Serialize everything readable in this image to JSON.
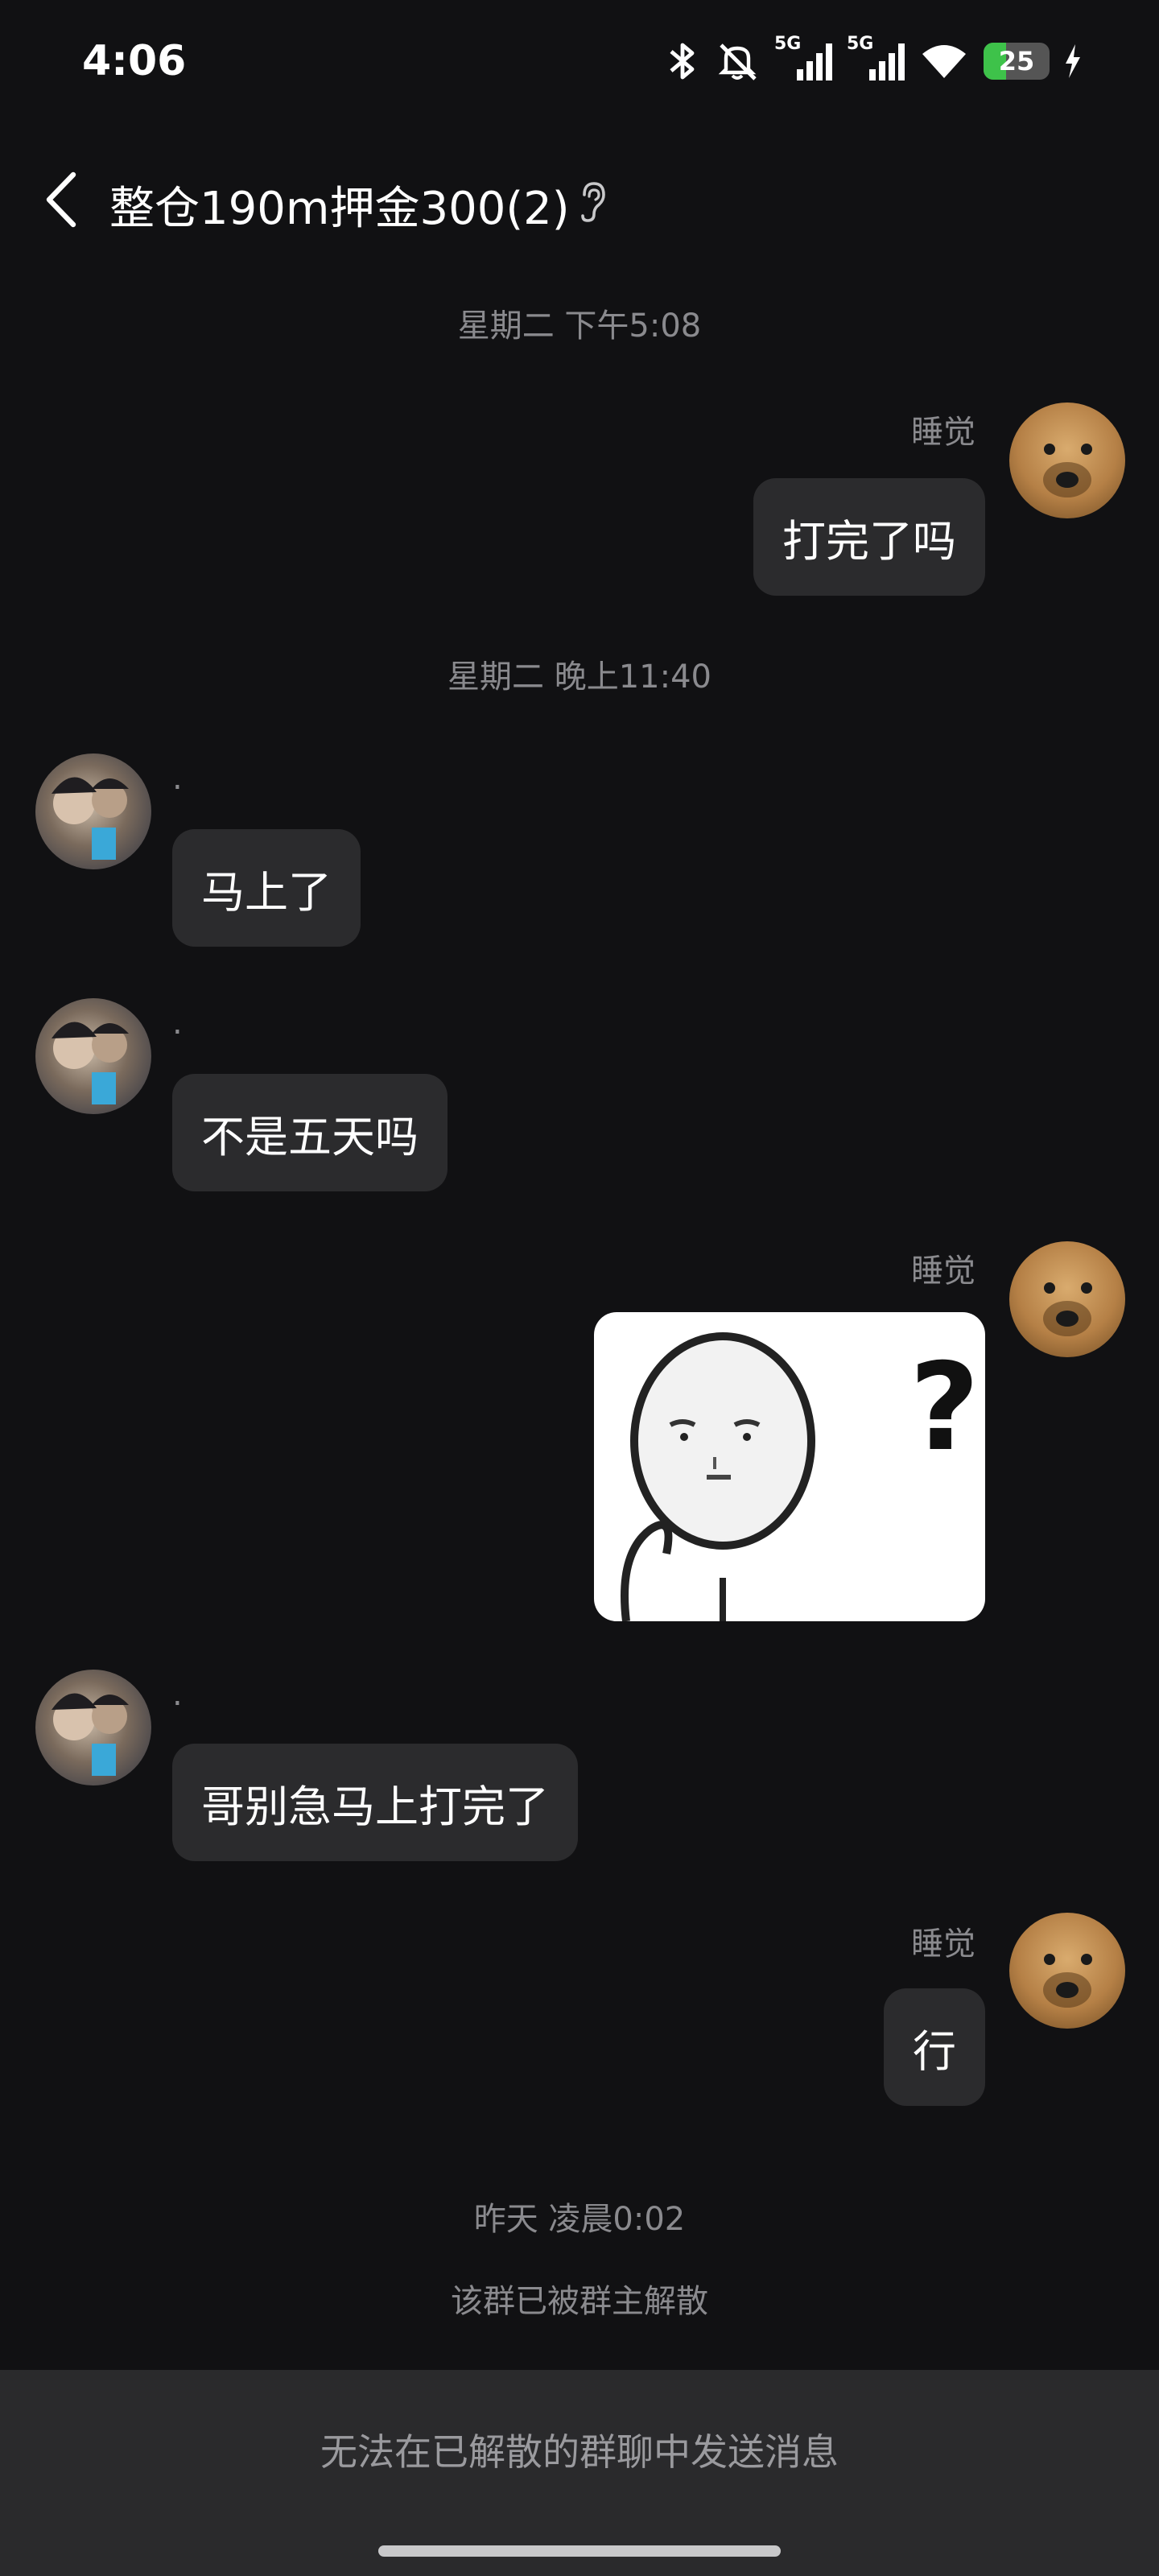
{
  "status_bar": {
    "time": "4:06",
    "battery": "25",
    "network_1": "5G",
    "network_2": "5G",
    "icons": [
      "bluetooth-icon",
      "mute-icon",
      "signal-icon",
      "signal-icon",
      "wifi-icon",
      "battery-icon",
      "charging-icon"
    ]
  },
  "header": {
    "title": "整仓190m押金300(2)",
    "back_icon": "chevron-left-icon",
    "ear_icon": "ear-icon"
  },
  "messages": {
    "timestamp_1": "星期二 下午5:08",
    "msg_1": {
      "sender": "睡觉",
      "text": "打完了吗"
    },
    "timestamp_2": "星期二 晚上11:40",
    "msg_2": {
      "sender": ".",
      "text": "马上了"
    },
    "msg_3": {
      "sender": ".",
      "text": "不是五天吗"
    },
    "msg_4": {
      "sender": "睡觉",
      "sticker_text": "?"
    },
    "msg_5": {
      "sender": ".",
      "text": "哥别急马上打完了"
    },
    "msg_6": {
      "sender": "睡觉",
      "text": "行"
    },
    "timestamp_3": "昨天 凌晨0:02",
    "system_notice": "该群已被群主解散"
  },
  "bottom": {
    "cannot_send": "无法在已解散的群聊中发送消息"
  },
  "colors": {
    "background": "#111113",
    "bubble": "#2b2b2d",
    "muted_text": "#8a8a8e",
    "battery_green": "#3ec24a"
  }
}
